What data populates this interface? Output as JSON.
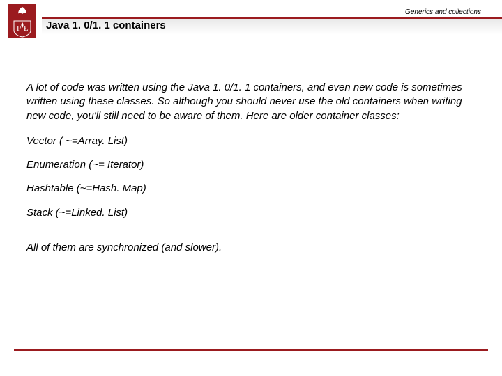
{
  "header": {
    "topic": "Generics and collections",
    "title": "Java 1. 0/1. 1 containers",
    "logo_alt": "institution-crest"
  },
  "content": {
    "intro": "A lot of code was written using the Java 1. 0/1. 1 containers, and even new code is sometimes written using these classes. So although you should never use the old containers when writing new code, you'll still need to be aware of them. Here are older container classes:",
    "items": {
      "vector": "Vector ( ~=Array. List)",
      "enumeration": "Enumeration (~= Iterator)",
      "hashtable": "Hashtable (~=Hash. Map)",
      "stack": "Stack (~=Linked. List)"
    },
    "footnote": "All of them are synchronized (and slower)."
  }
}
